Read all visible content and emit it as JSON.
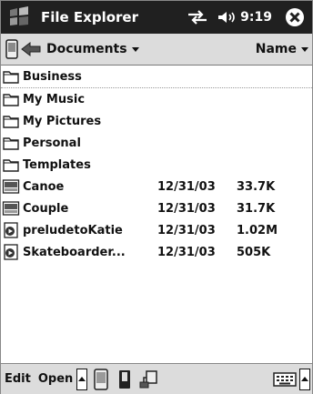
{
  "titlebar": {
    "app_title": "File Explorer",
    "time": "9:19"
  },
  "navbar": {
    "folder": "Documents",
    "sort": "Name"
  },
  "files": [
    {
      "name": "Business",
      "date": "",
      "size": "",
      "icon": "folder-icon"
    },
    {
      "name": "My Music",
      "date": "",
      "size": "",
      "icon": "folder-icon"
    },
    {
      "name": "My Pictures",
      "date": "",
      "size": "",
      "icon": "folder-icon"
    },
    {
      "name": "Personal",
      "date": "",
      "size": "",
      "icon": "folder-icon"
    },
    {
      "name": "Templates",
      "date": "",
      "size": "",
      "icon": "folder-icon"
    },
    {
      "name": "Canoe",
      "date": "12/31/03",
      "size": "33.7K",
      "icon": "jpg-file-icon"
    },
    {
      "name": "Couple",
      "date": "12/31/03",
      "size": "31.7K",
      "icon": "jpg-file-icon"
    },
    {
      "name": "preludetoKatie",
      "date": "12/31/03",
      "size": "1.02M",
      "icon": "media-file-icon"
    },
    {
      "name": "Skateboarder...",
      "date": "12/31/03",
      "size": "505K",
      "icon": "media-file-icon"
    }
  ],
  "bottombar": {
    "edit_label": "Edit",
    "open_label": "Open"
  }
}
